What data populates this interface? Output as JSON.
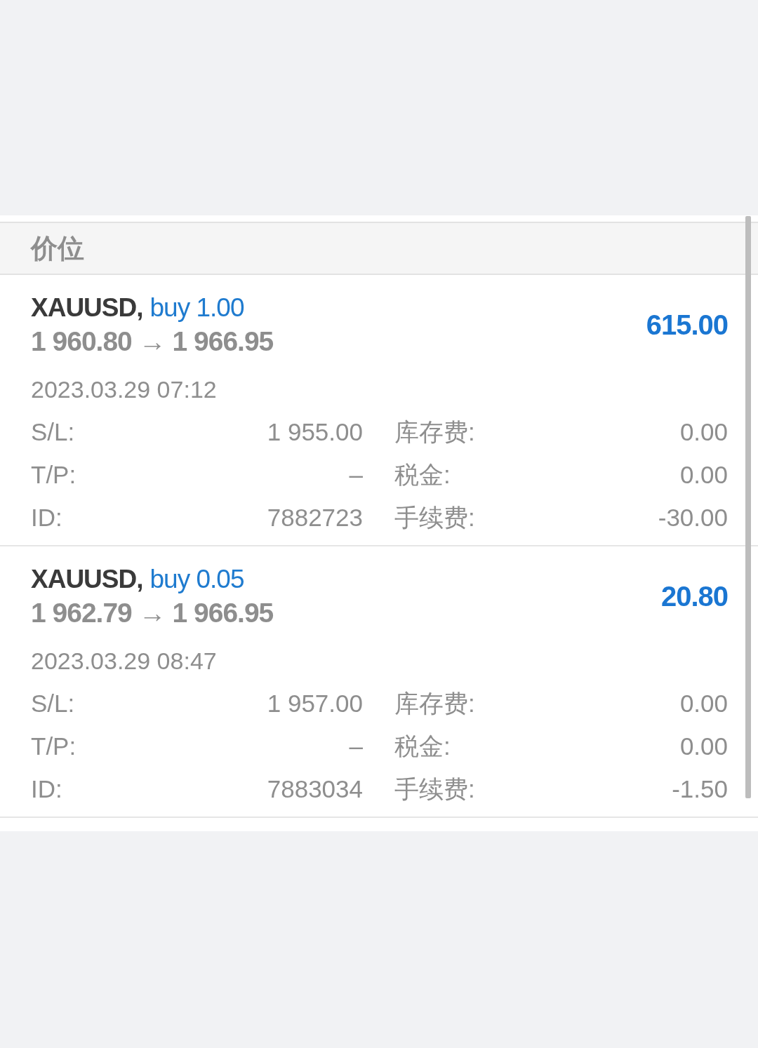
{
  "header": {
    "title": "价位"
  },
  "positions": [
    {
      "symbol": "XAUUSD,",
      "order": "buy 1.00",
      "prices": "1 960.80 → 1 966.95",
      "profit": "615.00",
      "time": "2023.03.29 07:12",
      "fields": [
        {
          "label": "S/L:",
          "value": "1 955.00"
        },
        {
          "label": "库存费:",
          "value": "0.00"
        },
        {
          "label": "T/P:",
          "value": "–"
        },
        {
          "label": "税金:",
          "value": "0.00"
        },
        {
          "label": "ID:",
          "value": "7882723"
        },
        {
          "label": "手续费:",
          "value": "-30.00"
        }
      ]
    },
    {
      "symbol": "XAUUSD,",
      "order": "buy 0.05",
      "prices": "1 962.79 → 1 966.95",
      "profit": "20.80",
      "time": "2023.03.29 08:47",
      "fields": [
        {
          "label": "S/L:",
          "value": "1 957.00"
        },
        {
          "label": "库存费:",
          "value": "0.00"
        },
        {
          "label": "T/P:",
          "value": "–"
        },
        {
          "label": "税金:",
          "value": "0.00"
        },
        {
          "label": "ID:",
          "value": "7883034"
        },
        {
          "label": "手续费:",
          "value": "-1.50"
        }
      ]
    }
  ]
}
